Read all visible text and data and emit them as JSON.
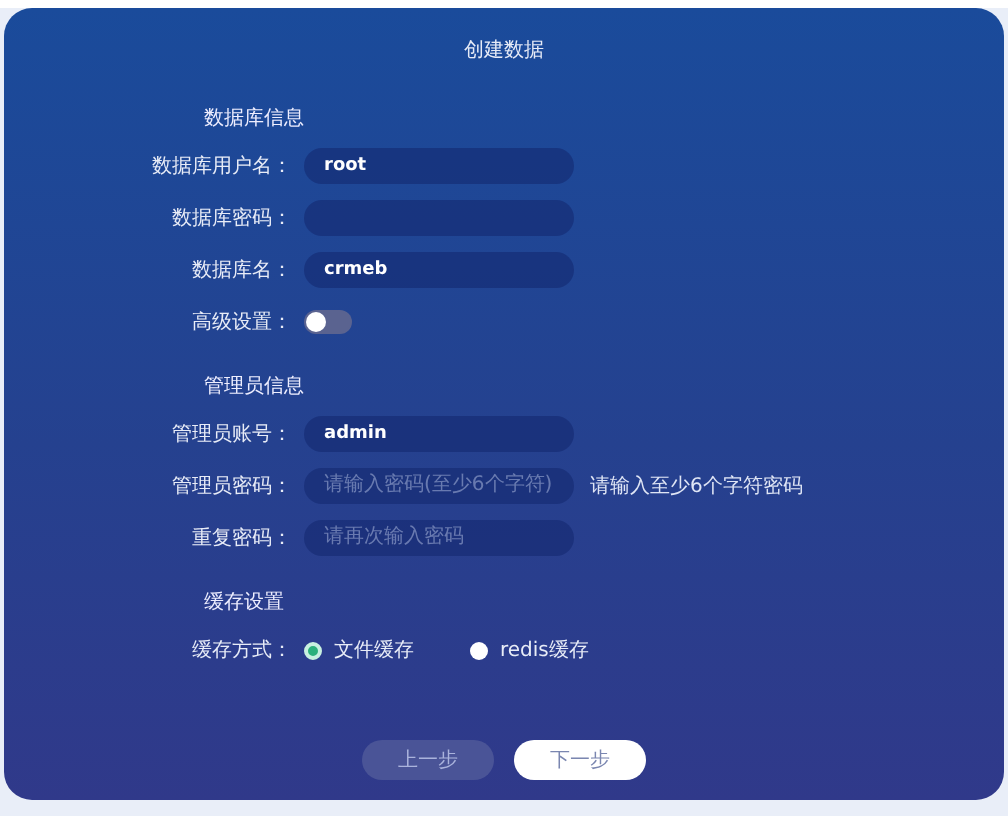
{
  "title": "创建数据",
  "sections": [
    {
      "heading": "数据库信息",
      "rows": [
        {
          "kind": "text",
          "label": "数据库用户名：",
          "value": "root"
        },
        {
          "kind": "text",
          "label": "数据库密码："
        },
        {
          "kind": "text",
          "label": "数据库名：",
          "value": "crmeb"
        },
        {
          "kind": "toggle",
          "label": "高级设置：",
          "on": false
        }
      ]
    },
    {
      "heading": "管理员信息",
      "rows": [
        {
          "kind": "text",
          "label": "管理员账号：",
          "value": "admin"
        },
        {
          "kind": "text",
          "label": "管理员密码：",
          "placeholder": "请输入密码(至少6个字符)",
          "hint": "请输入至少6个字符密码"
        },
        {
          "kind": "text",
          "label": "重复密码：",
          "placeholder": "请再次输入密码"
        }
      ]
    },
    {
      "heading": "缓存设置",
      "rows": [
        {
          "kind": "radio",
          "label": "缓存方式：",
          "options": [
            {
              "label": "文件缓存",
              "selected": true
            },
            {
              "label": "redis缓存",
              "selected": false
            }
          ]
        }
      ]
    }
  ],
  "buttons": [
    {
      "label": "上一步",
      "primary": false
    },
    {
      "label": "下一步",
      "primary": true
    }
  ]
}
